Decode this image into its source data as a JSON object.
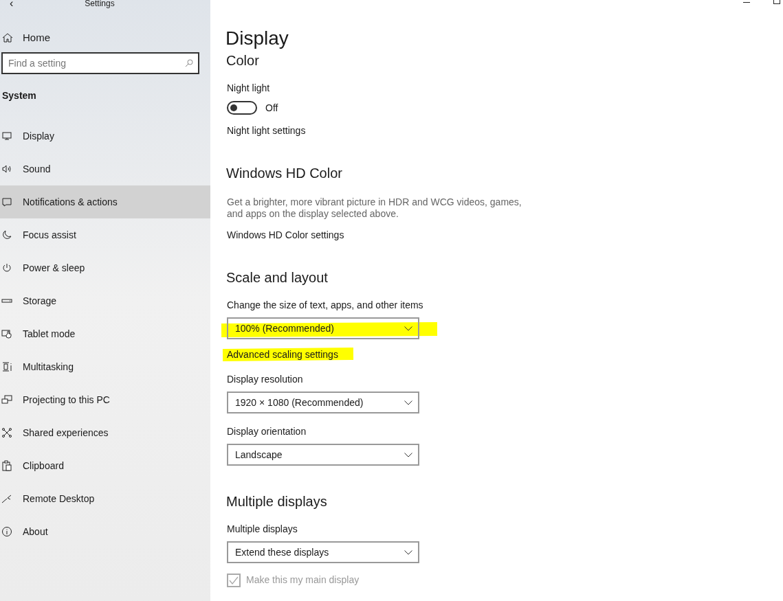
{
  "window": {
    "title": "Settings",
    "back": "‹"
  },
  "sidebar": {
    "home": "Home",
    "search": {
      "placeholder": "Find a setting"
    },
    "group": "System",
    "items": [
      {
        "label": "Display",
        "selected": false
      },
      {
        "label": "Sound",
        "selected": false
      },
      {
        "label": "Notifications & actions",
        "selected": true
      },
      {
        "label": "Focus assist",
        "selected": false
      },
      {
        "label": "Power & sleep",
        "selected": false
      },
      {
        "label": "Storage",
        "selected": false
      },
      {
        "label": "Tablet mode",
        "selected": false
      },
      {
        "label": "Multitasking",
        "selected": false
      },
      {
        "label": "Projecting to this PC",
        "selected": false
      },
      {
        "label": "Shared experiences",
        "selected": false
      },
      {
        "label": "Clipboard",
        "selected": false
      },
      {
        "label": "Remote Desktop",
        "selected": false
      },
      {
        "label": "About",
        "selected": false
      }
    ]
  },
  "page": {
    "title": "Display",
    "items": [
      {
        "kind": "heading",
        "text": "Color"
      },
      {
        "kind": "label",
        "text": "Night light"
      },
      {
        "kind": "toggle",
        "on": false,
        "text": "Off"
      },
      {
        "kind": "link",
        "text": "Night light settings",
        "highlighted": false
      },
      {
        "kind": "heading",
        "text": "Windows HD Color"
      },
      {
        "kind": "text",
        "text": "Get a brighter, more vibrant picture in HDR and WCG videos, games, and apps on the display selected above."
      },
      {
        "kind": "link",
        "text": "Windows HD Color settings",
        "highlighted": false
      },
      {
        "kind": "heading",
        "text": "Scale and layout"
      },
      {
        "kind": "label",
        "text": "Change the size of text, apps, and other items"
      },
      {
        "kind": "dropdown",
        "value": "100% (Recommended)",
        "highlighted": true
      },
      {
        "kind": "link",
        "text": "Advanced scaling settings",
        "highlighted": true
      },
      {
        "kind": "label",
        "text": "Display resolution"
      },
      {
        "kind": "dropdown",
        "value": "1920 × 1080 (Recommended)",
        "highlighted": false
      },
      {
        "kind": "label",
        "text": "Display orientation"
      },
      {
        "kind": "dropdown",
        "value": "Landscape",
        "highlighted": false
      },
      {
        "kind": "heading",
        "text": "Multiple displays"
      },
      {
        "kind": "label",
        "text": "Multiple displays"
      },
      {
        "kind": "dropdown",
        "value": "Extend these displays",
        "highlighted": false
      },
      {
        "kind": "checkbox",
        "text": "Make this my main display",
        "checked": true,
        "disabled": true
      }
    ]
  }
}
